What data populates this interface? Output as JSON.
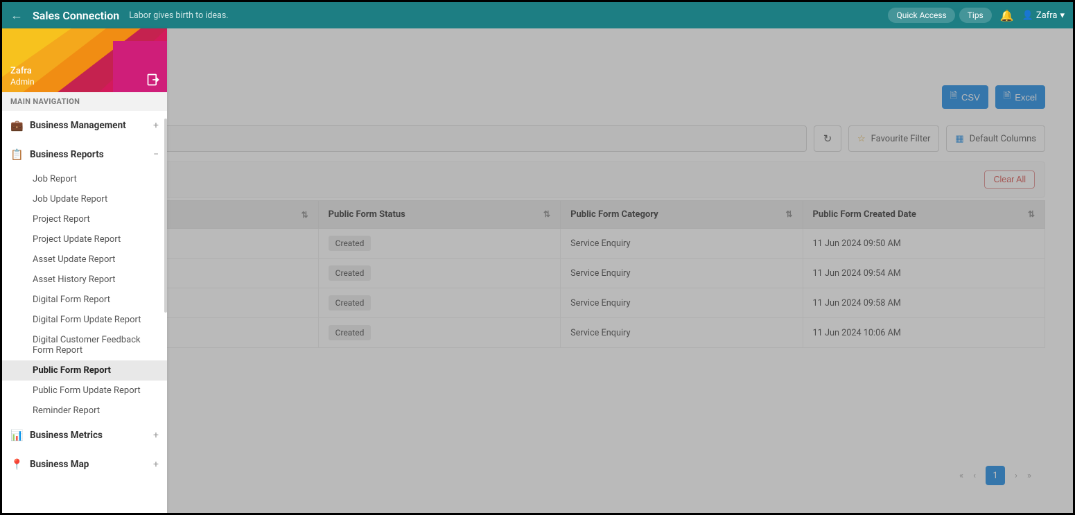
{
  "header": {
    "brand": "Sales Connection",
    "tagline": "Labor gives birth to ideas.",
    "quick_access": "Quick Access",
    "tips": "Tips",
    "user": "Zafra"
  },
  "sidebar": {
    "user_name": "Zafra",
    "user_role": "Admin",
    "nav_title": "MAIN NAVIGATION",
    "groups": [
      {
        "label": "Business Management",
        "icon": "briefcase",
        "expanded": false
      },
      {
        "label": "Business Reports",
        "icon": "clipboard",
        "expanded": true
      },
      {
        "label": "Business Metrics",
        "icon": "bar-chart",
        "expanded": false
      },
      {
        "label": "Business Map",
        "icon": "map-pin",
        "expanded": false
      }
    ],
    "report_items": [
      "Job Report",
      "Job Update Report",
      "Project Report",
      "Project Update Report",
      "Asset Update Report",
      "Asset History Report",
      "Digital Form Report",
      "Digital Form Update Report",
      "Digital Customer Feedback Form Report",
      "Public Form Report",
      "Public Form Update Report",
      "Reminder Report"
    ],
    "active_item_index": 9
  },
  "callout": {
    "number": "1"
  },
  "toolbar": {
    "csv": "CSV",
    "excel": "Excel",
    "favourite_filter": "Favourite Filter",
    "default_columns": "Default Columns",
    "clear_all": "Clear All"
  },
  "table": {
    "columns": [
      "",
      "Public Form Status",
      "Public Form Category",
      "Public Form Created Date"
    ],
    "rows": [
      {
        "status": "Created",
        "category": "Service Enquiry",
        "date": "11 Jun 2024 09:50 AM"
      },
      {
        "status": "Created",
        "category": "Service Enquiry",
        "date": "11 Jun 2024 09:54 AM"
      },
      {
        "status": "Created",
        "category": "Service Enquiry",
        "date": "11 Jun 2024 09:58 AM"
      },
      {
        "status": "Created",
        "category": "Service Enquiry",
        "date": "11 Jun 2024 10:06 AM"
      }
    ]
  },
  "pagination": {
    "current": "1"
  }
}
